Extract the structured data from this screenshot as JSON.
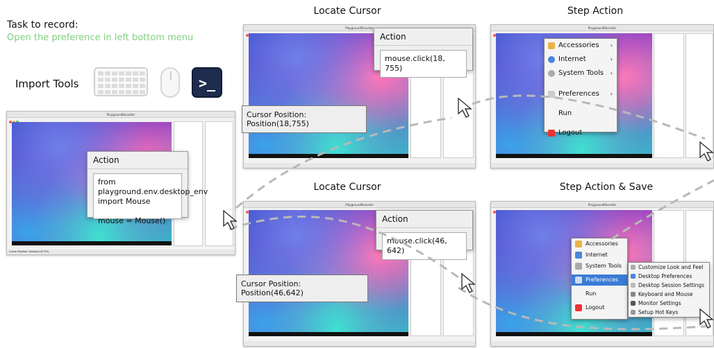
{
  "task": {
    "label": "Task to record:",
    "text": "Open the preference in left bottom menu"
  },
  "import_label": "Import Tools",
  "terminal_glyph": ">_",
  "app_title": "PlaygroundRecorder",
  "status_text": "Cursor Position: Position(18,755)",
  "first_window": {
    "action_title": "Action",
    "code": [
      "from",
      "playground.env.desktop_env",
      "import Mouse",
      "",
      "mouse = Mouse()"
    ]
  },
  "steps": [
    {
      "title": "Locate Cursor",
      "action_title": "Action",
      "code": "mouse.click(18, 755)",
      "cursor_text": "Cursor Position: Position(18,755)"
    },
    {
      "title": "Step Action"
    },
    {
      "title": "Locate Cursor",
      "action_title": "Action",
      "code": "mouse.click(46, 642)",
      "cursor_text": "Cursor Position: Position(46,642)"
    },
    {
      "title": "Step Action & Save"
    }
  ],
  "menu_main": [
    "Accessories",
    "Internet",
    "System Tools",
    "Preferences",
    "Run",
    "Logout"
  ],
  "menu_pref": [
    "Customize Look and Feel",
    "Desktop Preferences",
    "Desktop Session Settings",
    "Keyboard and Mouse",
    "Monitor Settings",
    "Setup Hot Keys"
  ],
  "colors": {
    "task_green": "#7fcf7f",
    "terminal": "#1d2b4f",
    "dash": "#b8b8b8"
  }
}
